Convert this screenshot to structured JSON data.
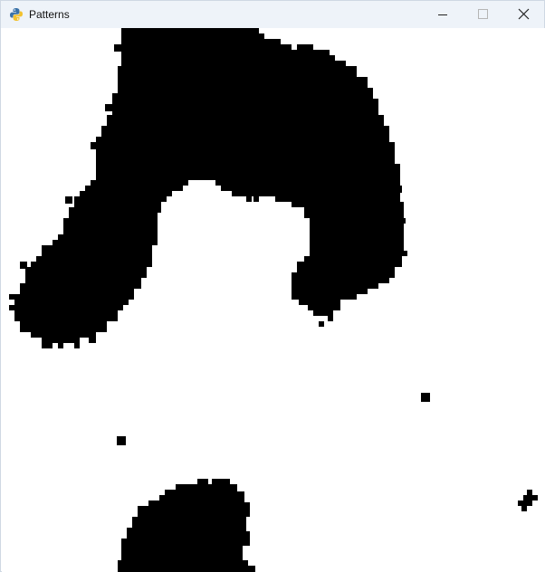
{
  "window": {
    "title": "Patterns",
    "app_icon": "python-snake-icon",
    "controls": {
      "minimize_icon": "minimize-icon",
      "maximize_icon": "maximize-icon",
      "close_icon": "close-icon"
    }
  },
  "canvas": {
    "background_color": "#ffffff",
    "cell_color": "#000000",
    "description_icon": "pattern-grid"
  },
  "colors": {
    "titlebar": "#eef3f9",
    "title_text": "#111111"
  }
}
